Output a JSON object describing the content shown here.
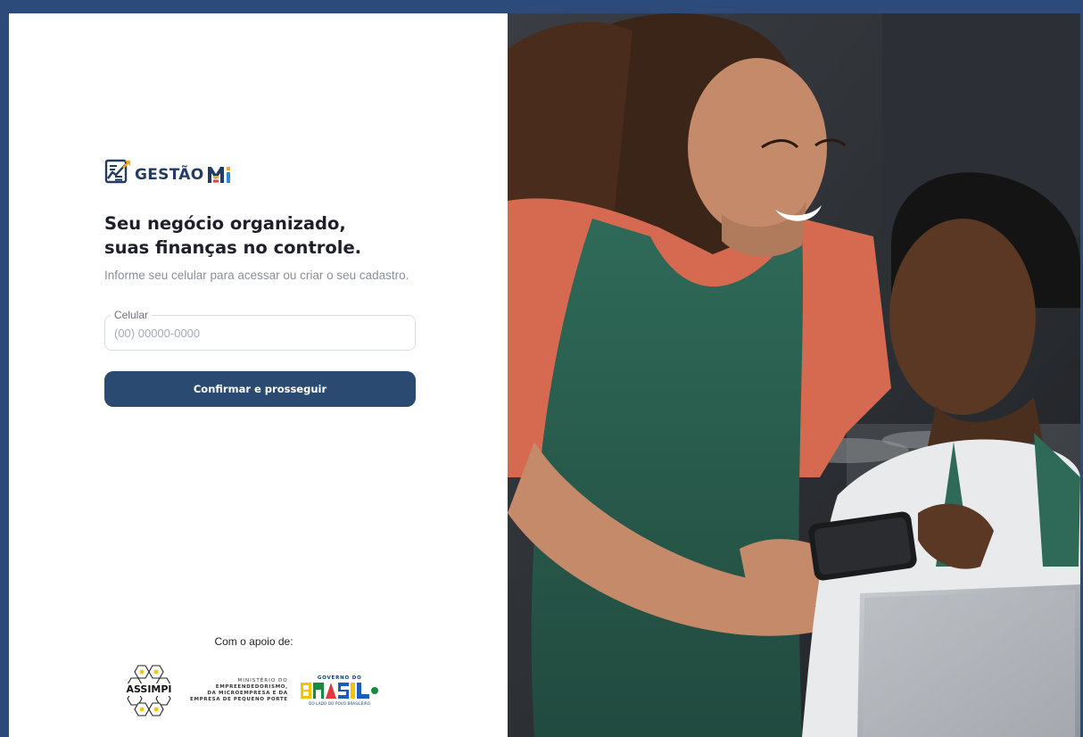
{
  "brand": {
    "name": "GESTÃO",
    "suffix": "MEI"
  },
  "hero": {
    "headline_line1": "Seu negócio organizado,",
    "headline_line2": "suas finanças no controle.",
    "subtitle": "Informe seu celular para acessar ou criar o seu cadastro."
  },
  "form": {
    "phone_label": "Celular",
    "phone_placeholder": "(00) 00000-0000",
    "phone_value": "",
    "submit_label": "Confirmar e prosseguir"
  },
  "support": {
    "heading": "Com o apoio de:",
    "assimpi": "ASSIMPI",
    "ministry_line1": "MINISTÉRIO DO",
    "ministry_line2": "EMPREENDEDORISMO,",
    "ministry_line3": "DA MICROEMPRESA E DA",
    "ministry_line4": "EMPRESA DE PEQUENO PORTE",
    "gov_top": "GOVERNO DO",
    "gov_word": "BRASIL",
    "gov_tagline": "DO LADO DO POVO BRASILEIRO"
  },
  "colors": {
    "primary": "#2b4a72",
    "frame": "#2d4b7a",
    "accent_orange": "#f5a623",
    "text": "#1f1f2b"
  },
  "photo": {
    "icon": "photo-two-people-with-smartphone"
  }
}
